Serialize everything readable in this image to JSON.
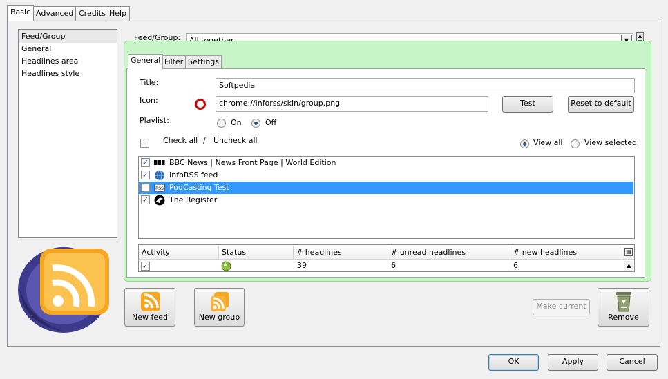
{
  "tabs": [
    "Basic",
    "Advanced",
    "Credits",
    "Help"
  ],
  "nav": {
    "items": [
      "Feed/Group",
      "General",
      "Headlines area",
      "Headlines style"
    ],
    "selected_index": 0
  },
  "feed_group": {
    "label": "Feed/Group:",
    "selected": "All together"
  },
  "subtabs": [
    "General",
    "Filter",
    "Settings"
  ],
  "form": {
    "title_label": "Title:",
    "title_value": "Softpedia",
    "icon_label": "Icon:",
    "icon_value": "chrome://inforss/skin/group.png",
    "test_button": "Test",
    "reset_button": "Reset to default",
    "playlist_label": "Playlist:",
    "playlist_on": "On",
    "playlist_off": "Off",
    "playlist_selected": "Off",
    "check_all": "Check all",
    "separator": "/",
    "uncheck_all": "Uncheck all",
    "view_all": "View all",
    "view_selected": "View selected",
    "view_mode_selected": "View all"
  },
  "feeds": [
    {
      "name": "BBC News | News Front Page | World Edition",
      "checked": true,
      "icon": "bbc-logo-icon",
      "selected": false
    },
    {
      "name": "InfoRSS feed",
      "checked": true,
      "icon": "globe-icon",
      "selected": false
    },
    {
      "name": "PodCasting Test",
      "checked": false,
      "icon": "rss-badge-icon",
      "selected": true
    },
    {
      "name": "The Register",
      "checked": true,
      "icon": "register-logo-icon",
      "selected": false
    }
  ],
  "table": {
    "headers": [
      "Activity",
      "Status",
      "# headlines",
      "# unread headlines",
      "# new headlines"
    ],
    "row": {
      "activity_checked": true,
      "status_icon": "status-light-icon",
      "headlines": "39",
      "unread": "6",
      "new": "6"
    }
  },
  "actions": {
    "new_feed": "New feed",
    "new_group": "New group",
    "make_current": "Make current",
    "remove": "Remove"
  },
  "dialog": {
    "ok": "OK",
    "apply": "Apply",
    "cancel": "Cancel"
  },
  "colors": {
    "selection": "#3399ff",
    "green_panel": "#c8f5c8",
    "logo_orange": "#f5a623",
    "logo_purple": "#3c3a8a"
  }
}
